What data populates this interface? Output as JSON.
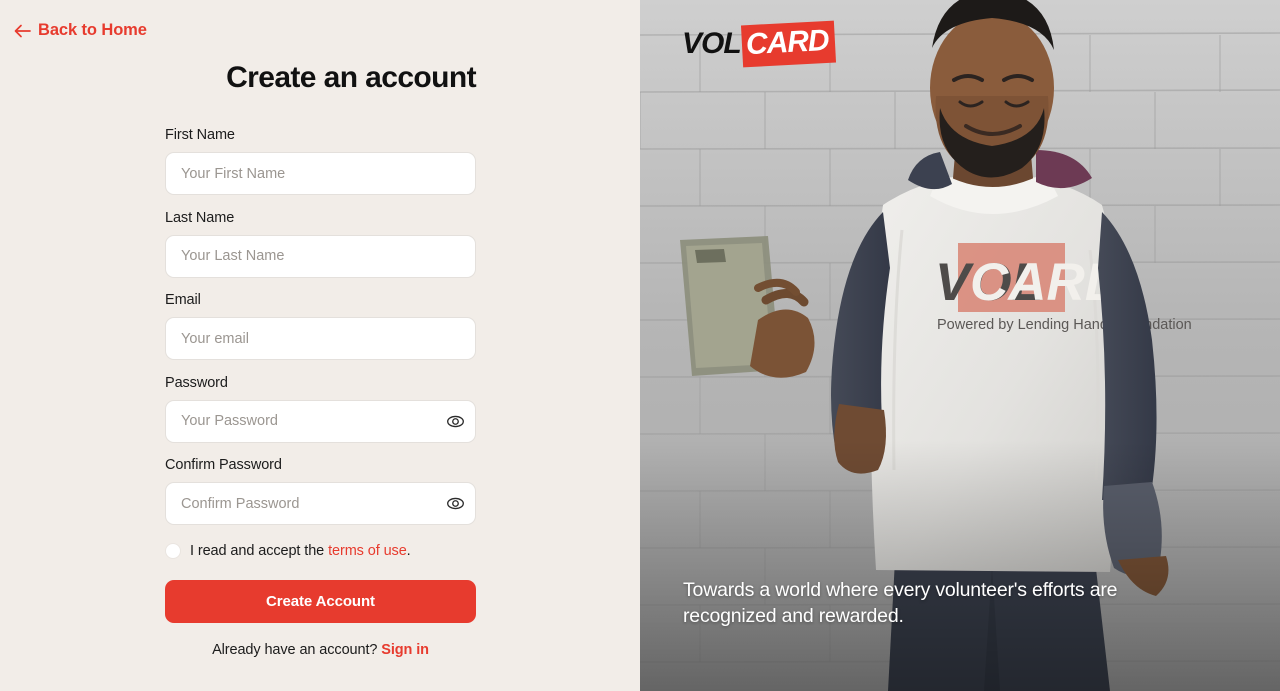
{
  "left": {
    "back_link": {
      "label": "Back to Home",
      "icon": "arrow-left-icon"
    },
    "title": "Create an account",
    "fields": [
      {
        "label": "First Name",
        "placeholder": "Your First Name",
        "value": "",
        "type": "text",
        "name": "first-name"
      },
      {
        "label": "Last Name",
        "placeholder": "Your Last Name",
        "value": "",
        "type": "text",
        "name": "last-name"
      },
      {
        "label": "Email",
        "placeholder": "Your email",
        "value": "",
        "type": "email",
        "name": "email"
      },
      {
        "label": "Password",
        "placeholder": "Your Password",
        "value": "",
        "type": "password",
        "name": "password",
        "icon": "eye-icon"
      },
      {
        "label": "Confirm Password",
        "placeholder": "Confirm Password",
        "value": "",
        "type": "password",
        "name": "confirm-password",
        "icon": "eye-icon"
      }
    ],
    "terms": {
      "checked": false,
      "text_before": "I read and accept the ",
      "link_label": "terms of use",
      "text_after": "."
    },
    "submit_label": "Create Account",
    "signin": {
      "text_before": "Already have an account? ",
      "link_label": "Sign in"
    }
  },
  "right": {
    "logo": {
      "part1": "VOL",
      "part2": "CARD"
    },
    "tagline": "Towards a world where every volunteer's efforts are recognized and rewarded.",
    "shirt_logo": {
      "part1": "VOL",
      "part2": "CARD",
      "subtitle": "Powered by Lending Hands Foundation"
    }
  },
  "colors": {
    "accent": "#e73b2e",
    "background": "#f2ede8",
    "text": "#1c1c1c",
    "placeholder": "#9b9691",
    "input_bg": "#ffffff"
  }
}
